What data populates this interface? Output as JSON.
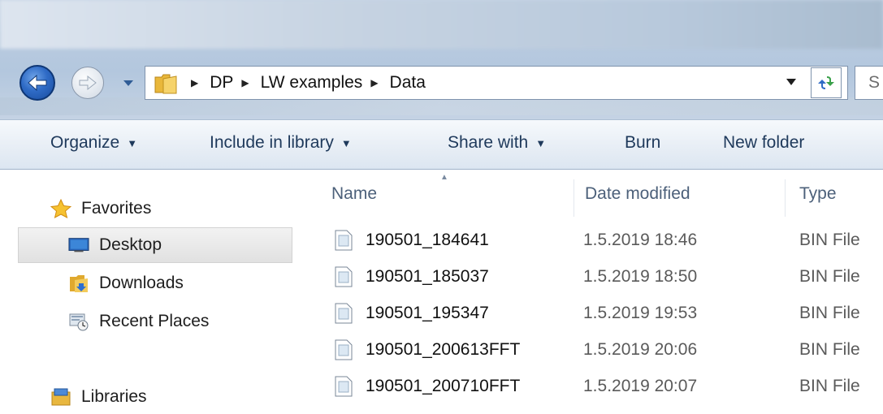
{
  "nav_buttons": {
    "back_icon": "back-arrow-icon",
    "forward_icon": "forward-arrow-icon"
  },
  "address": {
    "crumbs": [
      "DP",
      "LW examples",
      "Data"
    ],
    "search_placeholder": "S"
  },
  "commands": {
    "organize": "Organize",
    "include_in_library": "Include in library",
    "share_with": "Share with",
    "burn": "Burn",
    "new_folder": "New folder"
  },
  "navpane": {
    "favorites": "Favorites",
    "desktop": "Desktop",
    "downloads": "Downloads",
    "recent_places": "Recent Places",
    "libraries": "Libraries"
  },
  "columns": {
    "name": "Name",
    "date_modified": "Date modified",
    "type": "Type"
  },
  "files": [
    {
      "name": "190501_184641",
      "date": "1.5.2019 18:46",
      "type": "BIN File"
    },
    {
      "name": "190501_185037",
      "date": "1.5.2019 18:50",
      "type": "BIN File"
    },
    {
      "name": "190501_195347",
      "date": "1.5.2019 19:53",
      "type": "BIN File"
    },
    {
      "name": "190501_200613FFT",
      "date": "1.5.2019 20:06",
      "type": "BIN File"
    },
    {
      "name": "190501_200710FFT",
      "date": "1.5.2019 20:07",
      "type": "BIN File"
    }
  ],
  "colors": {
    "command_text": "#1e395b",
    "header_text": "#4c607a",
    "selection": "#e1e1e1"
  }
}
